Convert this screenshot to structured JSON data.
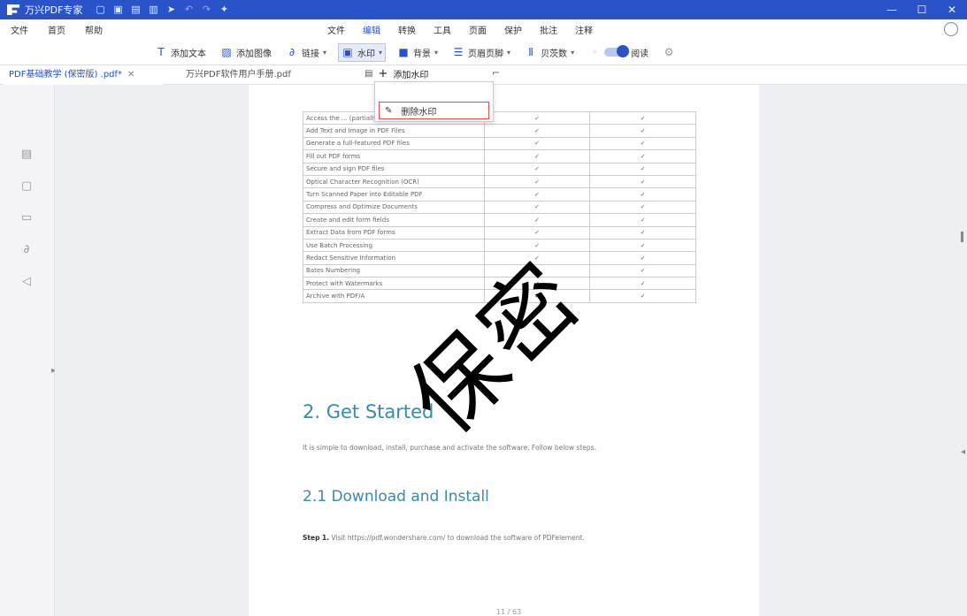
{
  "title_bar": {
    "app_name": "万兴PDF专家",
    "quick_icons": [
      "save-icon",
      "open-icon",
      "print-icon",
      "edit-icon",
      "share-icon",
      "undo-icon",
      "redo-icon",
      "pin-icon"
    ],
    "window_buttons": [
      "—",
      "☐",
      "✕"
    ]
  },
  "menu": {
    "left_items": [
      "文件",
      "首页",
      "帮助"
    ],
    "items": [
      "文件",
      "编辑",
      "转换",
      "工具",
      "页面",
      "保护",
      "批注",
      "注释"
    ],
    "active_index": 1
  },
  "toolbar": {
    "items": [
      {
        "label": "添加文本",
        "icon": "text-icon"
      },
      {
        "label": "添加图像",
        "icon": "image-icon"
      },
      {
        "label": "链接",
        "icon": "link-icon"
      },
      {
        "label": "水印",
        "icon": "watermark-icon",
        "selected": true
      },
      {
        "label": "背景",
        "icon": "background-icon"
      },
      {
        "label": "页眉页脚",
        "icon": "header-icon"
      },
      {
        "label": "贝茨数",
        "icon": "bates-icon"
      }
    ],
    "toggle_label": "阅读",
    "settings_icon": "gear-icon"
  },
  "tabs": [
    {
      "label": "PDF基础教学 (保密版) .pdf*"
    },
    {
      "label": "万兴PDF软件用户手册.pdf"
    }
  ],
  "dropdown": {
    "head_label": "添加水印",
    "item_label": "删除水印"
  },
  "document": {
    "table_rows": [
      [
        "Access the ... (partially hidden)",
        "✓",
        "✓"
      ],
      [
        "Add Text and Image in PDF Files",
        "✓",
        "✓"
      ],
      [
        "Generate a full-featured PDF files",
        "✓",
        "✓"
      ],
      [
        "Fill out PDF forms",
        "✓",
        "✓"
      ],
      [
        "Secure and sign PDF files",
        "✓",
        "✓"
      ],
      [
        "Optical Character Recognition (OCR)",
        "✓",
        "✓"
      ],
      [
        "Turn Scanned Paper into Editable PDF",
        "✓",
        "✓"
      ],
      [
        "Compress and Optimize Documents",
        "✓",
        "✓"
      ],
      [
        "Create and edit form fields",
        "✓",
        "✓"
      ],
      [
        "Extract Data from PDF forms",
        "✓",
        "✓"
      ],
      [
        "Use Batch Processing",
        "✓",
        "✓"
      ],
      [
        "Redact Sensitive Information",
        "✓",
        "✓"
      ],
      [
        "Bates Numbering",
        "✓",
        "✓"
      ],
      [
        "Protect with Watermarks",
        "✓",
        "✓"
      ],
      [
        "Archive with PDF/A",
        "✓",
        "✓"
      ]
    ],
    "heading": "2. Get Started",
    "paragraph": "It is simple to download, install, purchase and activate the software. Follow below steps.",
    "subheading": "2.1 Download and Install",
    "step_label": "Step 1.",
    "step_text": "Visit https://pdf.wondershare.com/ to download the software of PDFelement.",
    "page_number": "11 / 63",
    "watermark_text": "保密"
  }
}
